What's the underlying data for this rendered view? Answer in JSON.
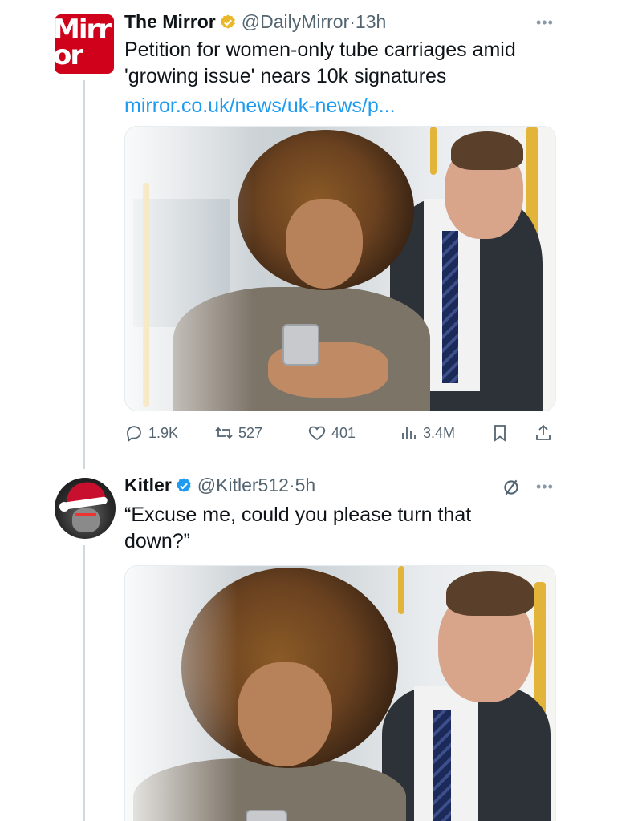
{
  "tweet1": {
    "author_name": "The Mirror",
    "handle": "@DailyMirror",
    "separator": "·",
    "time": "13h",
    "avatar_text_line1": "Mirr",
    "avatar_text_line2": "or",
    "text_line1": "Petition for women-only tube carriages amid",
    "text_line2": "'growing issue' nears 10k signatures",
    "link": "mirror.co.uk/news/uk-news/p...",
    "more_icon": "ellipsis-icon",
    "actions": {
      "replies": "1.9K",
      "retweets": "527",
      "likes": "401",
      "views": "3.4M"
    }
  },
  "tweet2": {
    "author_name": "Kitler",
    "handle": "@Kitler512",
    "separator": "·",
    "time": "5h",
    "text_line1": "“Excuse me, could you please turn that",
    "text_line2": "down?”",
    "more_icon": "ellipsis-icon"
  },
  "colors": {
    "verified_gold": "#e8b829",
    "verified_blue": "#1d9bf0",
    "link": "#1d9bf0",
    "mirror_red": "#d0021b",
    "muted": "#536471"
  }
}
